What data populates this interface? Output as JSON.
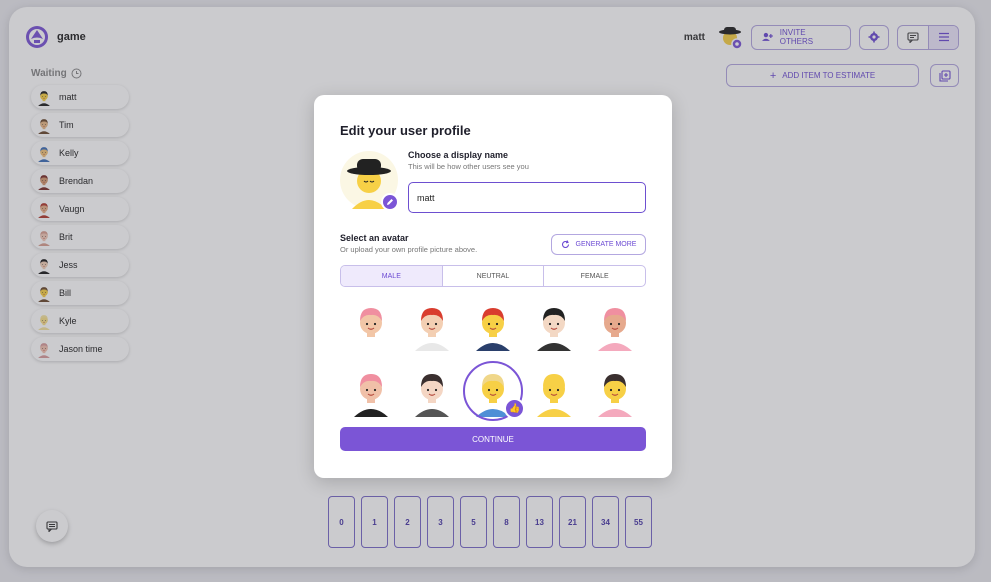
{
  "app": {
    "room_name": "game"
  },
  "header": {
    "username": "matt",
    "invite_label": "INVITE OTHERS",
    "add_item_label": "ADD ITEM TO ESTIMATE"
  },
  "waiting": {
    "title": "Waiting",
    "players": [
      {
        "name": "matt",
        "skin": "#f7d046",
        "hair": "#222222"
      },
      {
        "name": "Tim",
        "skin": "#e8b987",
        "hair": "#6b4a2e"
      },
      {
        "name": "Kelly",
        "skin": "#f0c27a",
        "hair": "#3f6fb8"
      },
      {
        "name": "Brendan",
        "skin": "#d59a72",
        "hair": "#7a2f2a"
      },
      {
        "name": "Vaugn",
        "skin": "#e7b08a",
        "hair": "#b23b2e"
      },
      {
        "name": "Brit",
        "skin": "#f2c9b8",
        "hair": "#d8a090"
      },
      {
        "name": "Jess",
        "skin": "#f2d0b8",
        "hair": "#1d1d1d"
      },
      {
        "name": "Bill",
        "skin": "#f7d046",
        "hair": "#6b4a2e"
      },
      {
        "name": "Kyle",
        "skin": "#f7e08a",
        "hair": "#f4e3a0"
      },
      {
        "name": "Jason time",
        "skin": "#f2c1b0",
        "hair": "#d89d9d"
      }
    ]
  },
  "cards": [
    "0",
    "1",
    "2",
    "3",
    "5",
    "8",
    "13",
    "21",
    "34",
    "55"
  ],
  "modal": {
    "title": "Edit your user profile",
    "display_name_label": "Choose a display name",
    "display_name_hint": "This will be how other users see you",
    "display_name_value": "matt",
    "avatar_label": "Select an avatar",
    "avatar_hint": "Or upload your own profile picture above.",
    "generate_label": "GENERATE MORE",
    "tabs": [
      "MALE",
      "NEUTRAL",
      "FEMALE"
    ],
    "active_tab": "MALE",
    "continue_label": "CONTINUE",
    "avatars": [
      {
        "name": "avatar-pink-afro",
        "skin": "#f2c6a7",
        "hair": "#f08fa0",
        "shirt": "#ffffff"
      },
      {
        "name": "avatar-red-hair",
        "skin": "#f3cfb3",
        "hair": "#d93d2e",
        "shirt": "#e8e8e8"
      },
      {
        "name": "avatar-red-quiff",
        "skin": "#f7d046",
        "hair": "#d93d2e",
        "shirt": "#2a3f6b"
      },
      {
        "name": "avatar-dark-bun",
        "skin": "#f3d8c4",
        "hair": "#222222",
        "shirt": "#333333"
      },
      {
        "name": "avatar-pink-beard",
        "skin": "#e6a98d",
        "hair": "#f08fa0",
        "shirt": "#f4a9bd"
      },
      {
        "name": "avatar-pink-hoodie",
        "skin": "#f0c0a8",
        "hair": "#f08fa0",
        "shirt": "#222222"
      },
      {
        "name": "avatar-dark-hair",
        "skin": "#f4d6c4",
        "hair": "#3a2f2f",
        "shirt": "#555555"
      },
      {
        "name": "avatar-glasses-blonde",
        "skin": "#f7d046",
        "hair": "#f0d78a",
        "shirt": "#4f8fd6"
      },
      {
        "name": "avatar-bald",
        "skin": "#f7d046",
        "hair": "#f7d046",
        "shirt": "#f7d046"
      },
      {
        "name": "avatar-dark-quiff",
        "skin": "#f7d046",
        "hair": "#3a2f2f",
        "shirt": "#f4a9bd"
      }
    ],
    "selected_avatar_index": 7
  },
  "colors": {
    "accent": "#7b55d6",
    "accent_light": "#efeafc"
  }
}
